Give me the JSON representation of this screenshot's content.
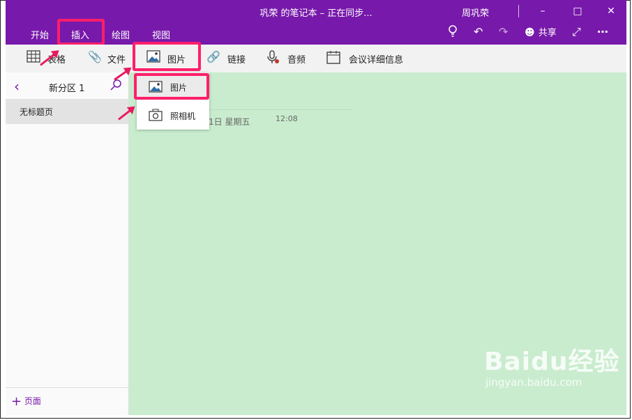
{
  "window": {
    "title": "巩荣 的笔记本 – 正在同步...",
    "user": "周巩荣",
    "controls": [
      "minimize",
      "maximize",
      "close"
    ]
  },
  "tabs": [
    {
      "label": "开始"
    },
    {
      "label": "插入"
    },
    {
      "label": "绘图"
    },
    {
      "label": "视图"
    }
  ],
  "header_actions": {
    "share_label": "共享"
  },
  "toolbar": {
    "table_label": "表格",
    "file_label": "文件",
    "picture_label": "图片",
    "link_label": "链接",
    "audio_label": "音频",
    "meeting_label": "会议详细信息"
  },
  "sidebar": {
    "section_title": "新分区 1",
    "pages": [
      {
        "label": "无标题页"
      }
    ],
    "add_page_label": "页面"
  },
  "dropdown": {
    "items": [
      {
        "label": "图片"
      },
      {
        "label": "照相机"
      }
    ]
  },
  "page": {
    "date": "1日 星期五",
    "time": "12:08"
  },
  "watermark": {
    "brand": "Baidu经验",
    "url": "jingyan.baidu.com"
  },
  "colors": {
    "accent": "#7719aa",
    "highlight": "#ff1f6b",
    "canvas": "#c9ecce"
  }
}
